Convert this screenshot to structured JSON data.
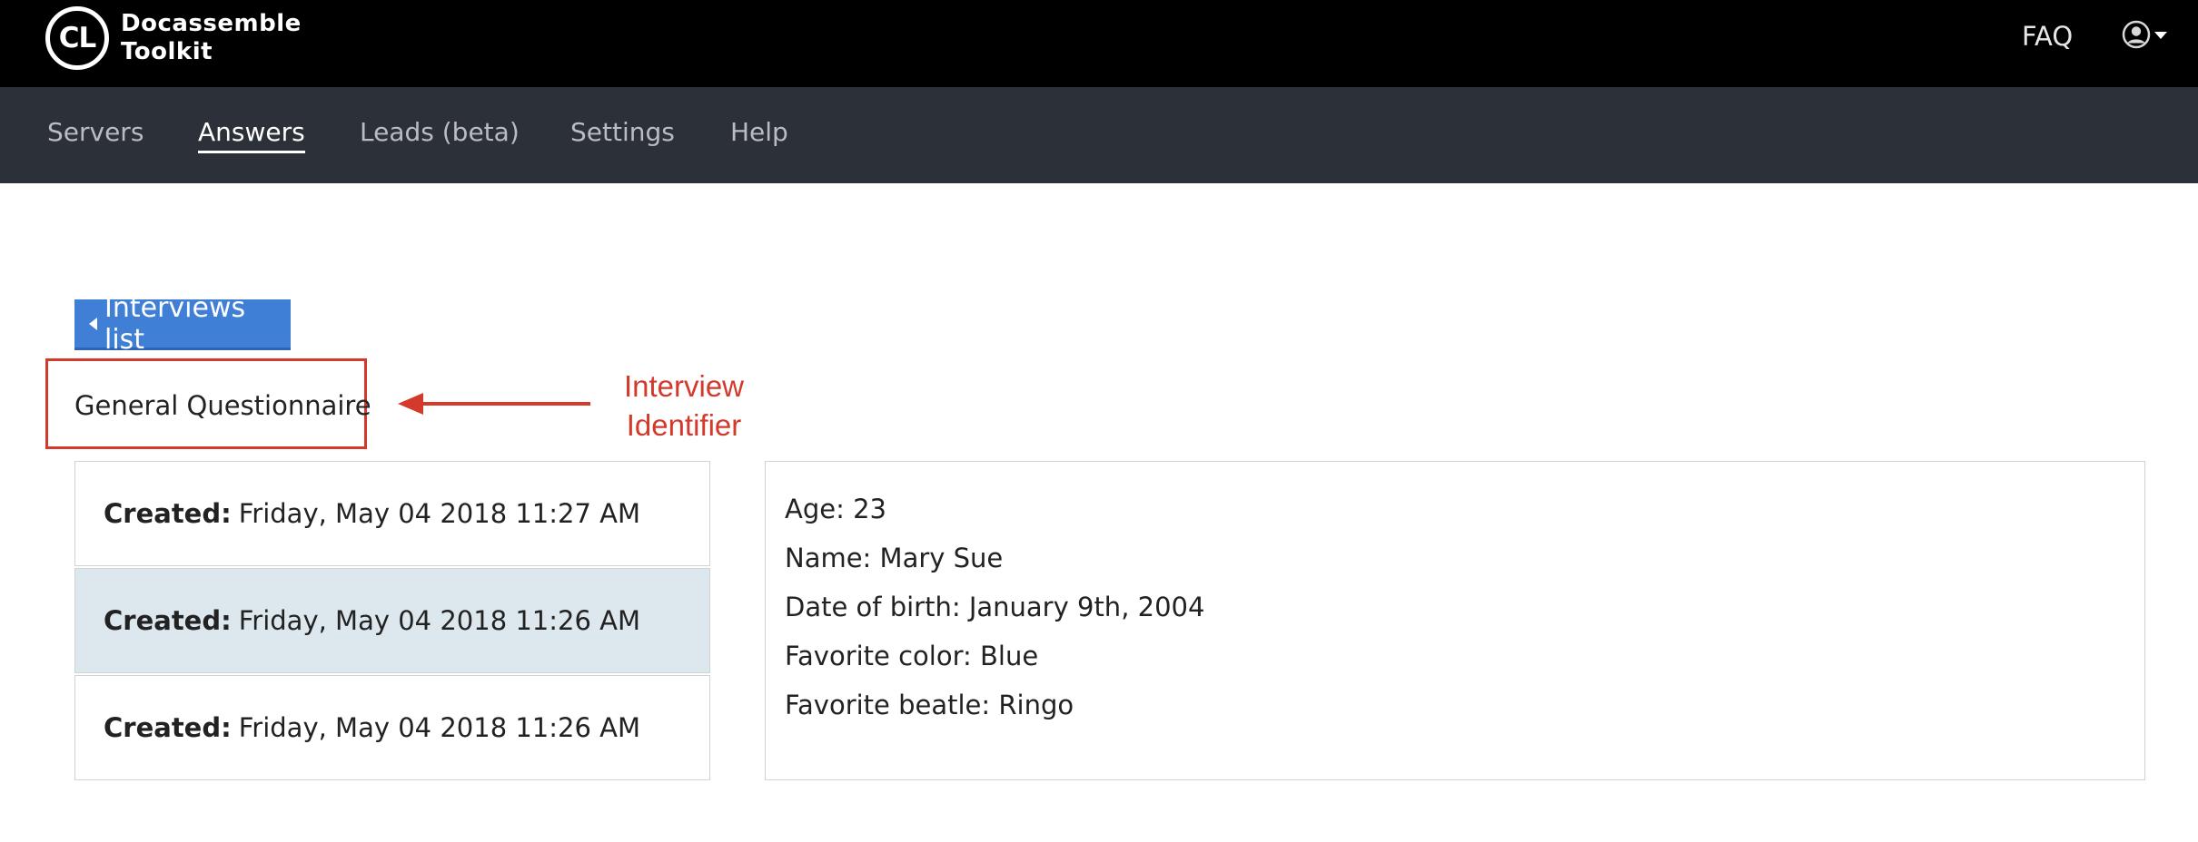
{
  "app": {
    "logo_mark": "CL",
    "logo_line1": "Docassemble",
    "logo_line2": "Toolkit",
    "faq_label": "FAQ",
    "user_icon": "user-circle-icon"
  },
  "nav": {
    "items": [
      {
        "label": "Servers"
      },
      {
        "label": "Answers"
      },
      {
        "label": "Leads (beta)"
      },
      {
        "label": "Settings"
      },
      {
        "label": "Help"
      }
    ],
    "active": "Answers"
  },
  "back_button": {
    "label": "Interviews list",
    "icon": "caret-left-icon"
  },
  "interview": {
    "identifier": "General Questionnaire"
  },
  "annotation": {
    "line1": "Interview",
    "line2": "Identifier",
    "color": "#d33a2c"
  },
  "sessions": [
    {
      "created_label": "Created:",
      "created_value": "Friday, May 04 2018 11:27 AM",
      "selected": false
    },
    {
      "created_label": "Created:",
      "created_value": "Friday, May 04 2018 11:26 AM",
      "selected": true
    },
    {
      "created_label": "Created:",
      "created_value": "Friday, May 04 2018 11:26 AM",
      "selected": false
    }
  ],
  "answers": [
    {
      "text": "Age: 23"
    },
    {
      "text": "Name: Mary Sue"
    },
    {
      "text": "Date of birth: January 9th, 2004"
    },
    {
      "text": "Favorite color: Blue"
    },
    {
      "text": "Favorite beatle: Ringo"
    }
  ],
  "colors": {
    "topbar": "#000000",
    "navbar": "#2c3038",
    "primary_button": "#3f7fd6",
    "selected_row": "#dce8ee"
  }
}
